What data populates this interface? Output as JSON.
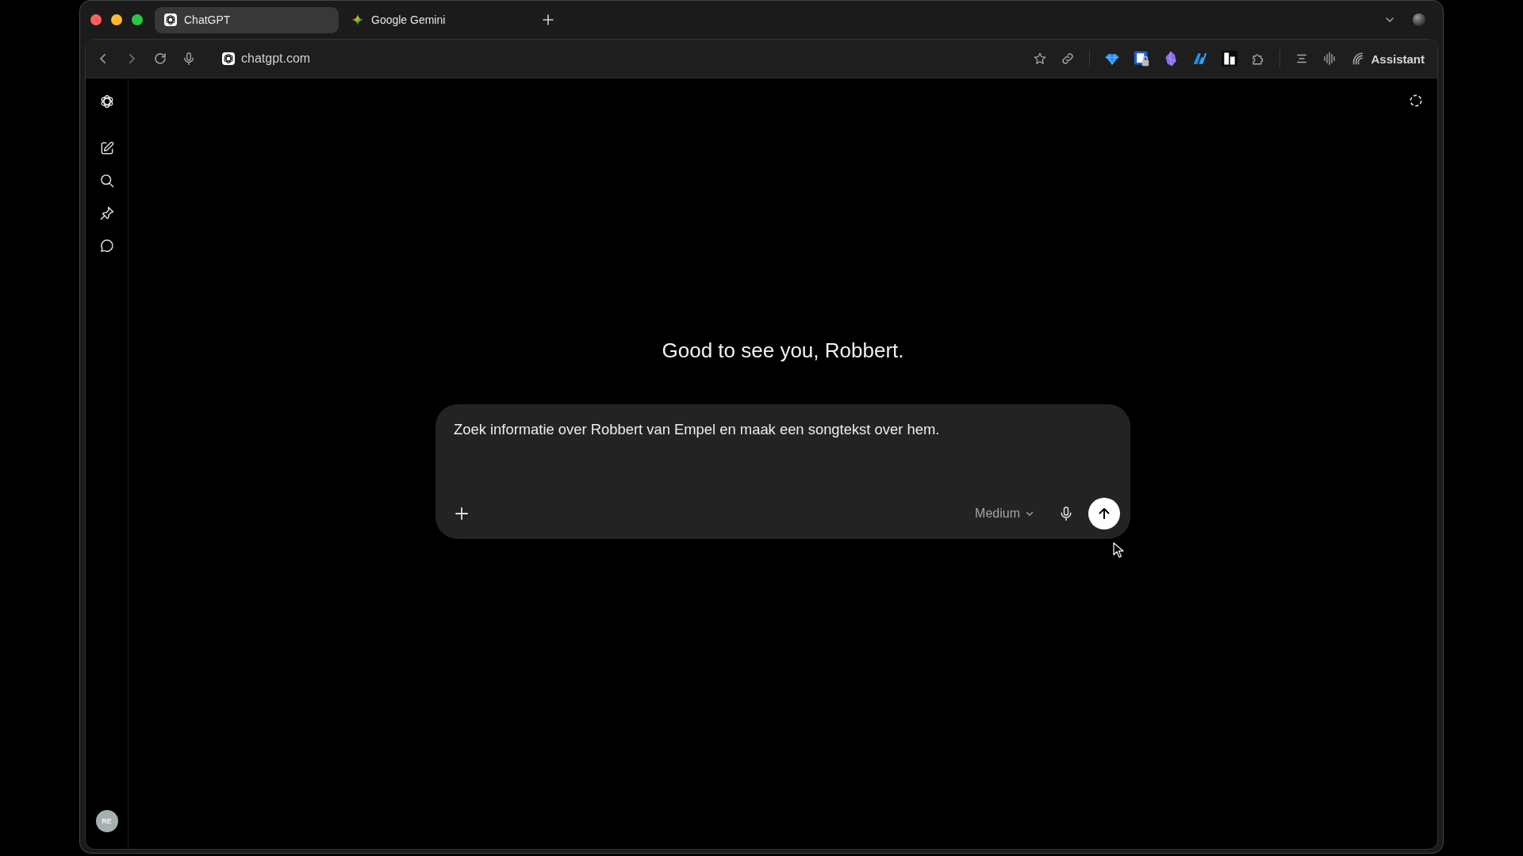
{
  "browser": {
    "tabs": [
      {
        "title": "ChatGPT",
        "kind": "chatgpt",
        "selected": true
      },
      {
        "title": "Google Gemini",
        "kind": "gemini",
        "selected": false
      }
    ],
    "address_bar": {
      "url": "chatgpt.com"
    },
    "assistant_button": {
      "label": "Assistant"
    }
  },
  "sidebar": {
    "avatar": {
      "initials": "RE"
    }
  },
  "main": {
    "greeting": "Good to see you, Robbert.",
    "composer": {
      "value": "Zoek informatie over Robbert van Empel en maak een songtekst over hem.",
      "mode": "Medium"
    }
  }
}
